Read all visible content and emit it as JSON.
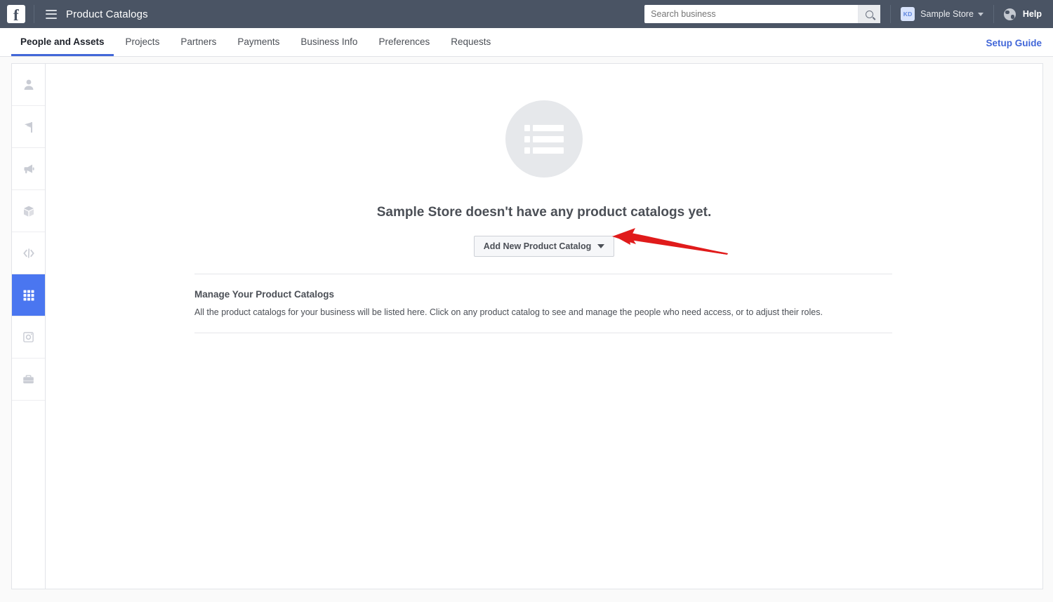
{
  "topbar": {
    "logo_icon": "facebook-logo-icon",
    "menu_icon": "hamburger-menu-icon",
    "title": "Product Catalogs",
    "search": {
      "placeholder": "Search business",
      "value": "",
      "icon": "search-icon"
    },
    "business": {
      "badge_initials": "KD",
      "name": "Sample Store",
      "caret_icon": "chevron-down-icon"
    },
    "globe_icon": "globe-icon",
    "help_label": "Help"
  },
  "tabs": {
    "items": [
      {
        "label": "People and Assets",
        "active": true
      },
      {
        "label": "Projects",
        "active": false
      },
      {
        "label": "Partners",
        "active": false
      },
      {
        "label": "Payments",
        "active": false
      },
      {
        "label": "Business Info",
        "active": false
      },
      {
        "label": "Preferences",
        "active": false
      },
      {
        "label": "Requests",
        "active": false
      }
    ],
    "setup_guide_label": "Setup Guide"
  },
  "sidebar": {
    "items": [
      {
        "icon": "person-icon",
        "active": false
      },
      {
        "icon": "flag-page-icon",
        "active": false
      },
      {
        "icon": "megaphone-ad-account-icon",
        "active": false
      },
      {
        "icon": "box-app-icon",
        "active": false
      },
      {
        "icon": "code-pixel-icon",
        "active": false
      },
      {
        "icon": "grid-product-catalogs-icon",
        "active": true
      },
      {
        "icon": "instagram-icon",
        "active": false
      },
      {
        "icon": "briefcase-icon",
        "active": false
      }
    ]
  },
  "empty_state": {
    "illustration_icon": "list-placeholder-icon",
    "title": "Sample Store doesn't have any product catalogs yet.",
    "button_label": "Add New Product Catalog",
    "button_caret_icon": "chevron-down-icon"
  },
  "manage_section": {
    "title": "Manage Your Product Catalogs",
    "description": "All the product catalogs for your business will be listed here. Click on any product catalog to see and manage the people who need access, or to adjust their roles."
  },
  "annotation": {
    "arrow_icon": "red-arrow-pointing-left-icon",
    "color": "#e01b1b"
  },
  "colors": {
    "topbar_bg": "#4a5464",
    "accent_blue": "#4267d8",
    "sidebar_active": "#4a76f0",
    "annotation_red": "#e01b1b"
  }
}
